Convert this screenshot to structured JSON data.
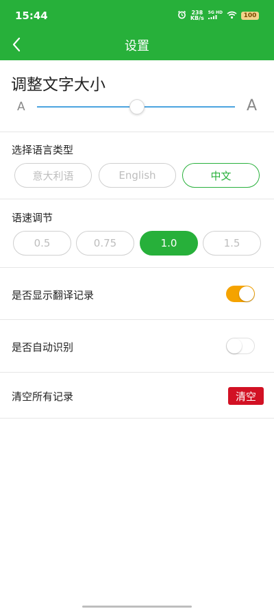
{
  "status_bar": {
    "time": "15:44",
    "net_speed_value": "238",
    "net_speed_unit": "KB/s",
    "network": "5G HD",
    "battery": "100"
  },
  "app_bar": {
    "title": "设置",
    "back_icon": "chevron-left-icon",
    "background_color": "#27b03a"
  },
  "font_size": {
    "title": "调整文字大小",
    "small_glyph": "A",
    "large_glyph": "A",
    "level": 0.5
  },
  "language": {
    "label": "选择语言类型",
    "options": [
      "意大利语",
      "English",
      "中文"
    ],
    "selected": "中文"
  },
  "speech_rate": {
    "label": "语速调节",
    "options": [
      "0.5",
      "0.75",
      "1.0",
      "1.5"
    ],
    "selected": "1.0"
  },
  "settings": {
    "show_translation_history": {
      "label": "是否显示翻译记录",
      "enabled": true
    },
    "auto_recognize": {
      "label": "是否自动识别",
      "enabled": false
    },
    "clear_records": {
      "label": "清空所有记录",
      "button_label": "清空"
    }
  },
  "colors": {
    "accent": "#27b03a",
    "toggle_on": "#f5a300",
    "danger": "#d21124",
    "slider": "#4aa3df"
  }
}
